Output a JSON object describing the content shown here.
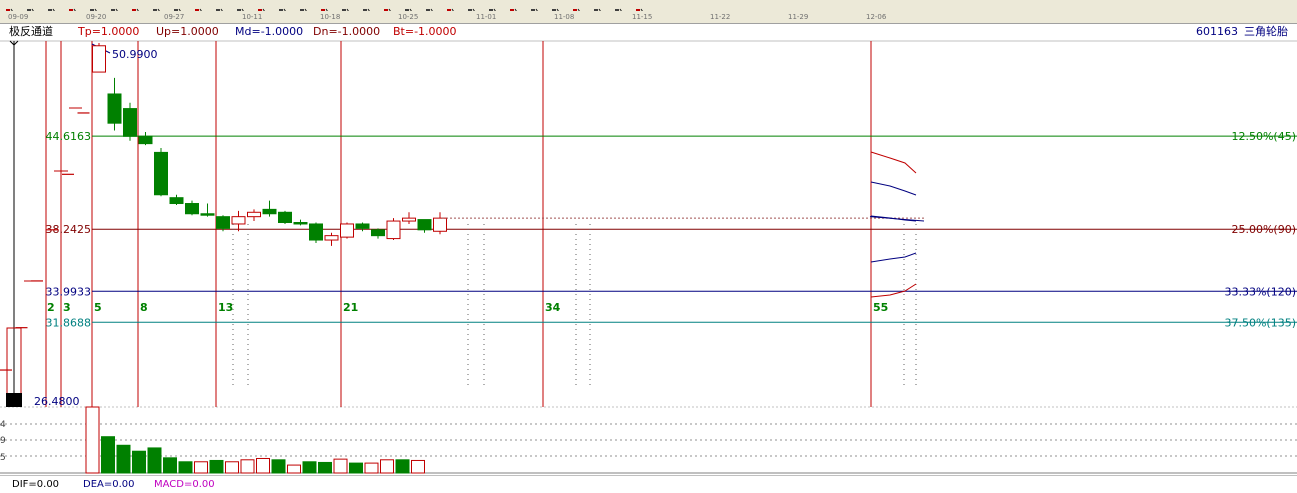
{
  "toolbar": {
    "icons": [
      "candle-icon",
      "candle-icon",
      "up-arrow-icon",
      "chart-icon",
      "grid-icon",
      "bar-icon",
      "draw-icon",
      "fan-icon",
      "line-icon",
      "hand-icon",
      "select-icon",
      "bars-icon",
      "window-icon",
      "cross-icon",
      "zoom-in-icon",
      "zoom-out-icon",
      "text-icon",
      "arrow-icon",
      "marker-icon",
      "table-icon",
      "layout-icon",
      "export-icon",
      "print-icon",
      "percent-icon",
      "ruler-icon",
      "compare-icon",
      "lines-icon",
      "lines2-icon",
      "lines3-icon",
      "lines4-icon",
      "lines5-icon"
    ],
    "percent_label": "%"
  },
  "dates": [
    "09-09",
    "09-20",
    "09-27",
    "10-11",
    "10-18",
    "10-25",
    "11-01",
    "11-08",
    "11-15",
    "11-22",
    "11-29",
    "12-06"
  ],
  "header": {
    "indicator": "极反通道",
    "tp": "Tp=1.0000",
    "up": "Up=1.0000",
    "md": "Md=-1.0000",
    "dn": "Dn=-1.0000",
    "bt": "Bt=-1.0000",
    "stock_code": "601163",
    "stock_name": "三角轮胎"
  },
  "footer": {
    "dif": "DIF=0.00",
    "dea": "DEA=0.00",
    "macd": "MACD=0.00"
  },
  "colors": {
    "up": "#c00000",
    "down": "#008000",
    "dark_red": "#800000",
    "navy": "#000080",
    "green_line": "#008000",
    "teal_line": "#008080",
    "fib_red": "#c00000"
  },
  "chart_data": {
    "type": "candlestick",
    "price_labels": {
      "high": "50.9900",
      "low": "26.4800",
      "level1": "44.6163",
      "level2": "38.2425",
      "level3": "33.9933",
      "level4": "31.8688"
    },
    "price_levels": [
      {
        "value": 44.6163,
        "label": "12.50%(45)",
        "color": "green"
      },
      {
        "value": 38.2425,
        "label": "25.00%(90)",
        "color": "darkred"
      },
      {
        "value": 33.9933,
        "label": "33.33%(120)",
        "color": "navy"
      },
      {
        "value": 31.8688,
        "label": "37.50%(135)",
        "color": "teal"
      }
    ],
    "fibonacci_labels": [
      "2",
      "3",
      "5",
      "8",
      "13",
      "21",
      "34",
      "55"
    ],
    "candles": [
      {
        "o": 26.48,
        "h": 26.48,
        "l": 26.48,
        "c": 26.48
      },
      {
        "o": 28.6,
        "h": 28.6,
        "l": 28.6,
        "c": 28.6
      },
      {
        "o": 31.5,
        "h": 31.5,
        "l": 31.5,
        "c": 31.5
      },
      {
        "o": 34.7,
        "h": 34.7,
        "l": 34.7,
        "c": 34.7
      },
      {
        "o": 38.2,
        "h": 38.2,
        "l": 38.2,
        "c": 38.2
      },
      {
        "o": 42.0,
        "h": 42.0,
        "l": 42.0,
        "c": 42.0
      },
      {
        "o": 46.2,
        "h": 46.2,
        "l": 46.2,
        "c": 46.2
      },
      {
        "o": 49.0,
        "h": 50.99,
        "l": 49.0,
        "c": 50.8
      },
      {
        "o": 47.5,
        "h": 48.6,
        "l": 45.0,
        "c": 45.5
      },
      {
        "o": 46.5,
        "h": 46.9,
        "l": 44.3,
        "c": 44.6
      },
      {
        "o": 44.6,
        "h": 44.9,
        "l": 44.0,
        "c": 44.1
      },
      {
        "o": 43.5,
        "h": 43.8,
        "l": 40.5,
        "c": 40.6
      },
      {
        "o": 40.4,
        "h": 40.6,
        "l": 39.9,
        "c": 40.0
      },
      {
        "o": 40.0,
        "h": 40.2,
        "l": 39.2,
        "c": 39.3
      },
      {
        "o": 39.3,
        "h": 40.0,
        "l": 39.1,
        "c": 39.2
      },
      {
        "o": 39.1,
        "h": 39.2,
        "l": 38.1,
        "c": 38.3
      },
      {
        "o": 38.6,
        "h": 39.5,
        "l": 38.1,
        "c": 39.1
      },
      {
        "o": 39.1,
        "h": 39.6,
        "l": 38.8,
        "c": 39.4
      },
      {
        "o": 39.6,
        "h": 40.2,
        "l": 39.1,
        "c": 39.3
      },
      {
        "o": 39.4,
        "h": 39.5,
        "l": 38.6,
        "c": 38.7
      },
      {
        "o": 38.7,
        "h": 38.9,
        "l": 38.5,
        "c": 38.6
      },
      {
        "o": 38.6,
        "h": 38.7,
        "l": 37.3,
        "c": 37.5
      },
      {
        "o": 37.5,
        "h": 38.0,
        "l": 37.1,
        "c": 37.8
      },
      {
        "o": 37.7,
        "h": 38.7,
        "l": 37.6,
        "c": 38.6
      },
      {
        "o": 38.6,
        "h": 38.7,
        "l": 38.1,
        "c": 38.3
      },
      {
        "o": 38.2,
        "h": 38.3,
        "l": 37.6,
        "c": 37.8
      },
      {
        "o": 37.6,
        "h": 39.0,
        "l": 37.5,
        "c": 38.8
      },
      {
        "o": 38.8,
        "h": 39.4,
        "l": 38.6,
        "c": 39.0
      },
      {
        "o": 38.9,
        "h": 38.9,
        "l": 38.0,
        "c": 38.2
      },
      {
        "o": 38.1,
        "h": 39.4,
        "l": 37.9,
        "c": 39.0
      }
    ],
    "volume_bar_count": 22
  }
}
